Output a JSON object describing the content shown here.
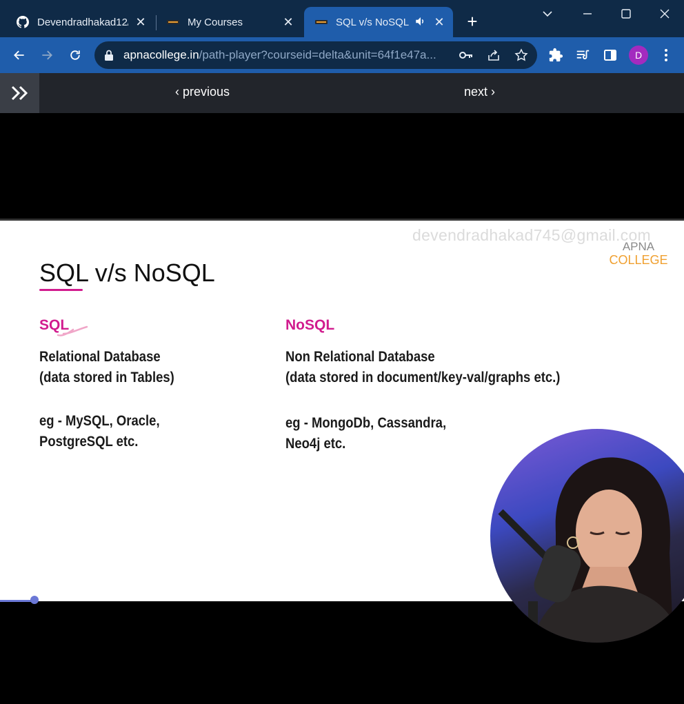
{
  "browser": {
    "tabs": [
      {
        "title": "Devendradhakad12/",
        "favicon": "github-icon"
      },
      {
        "title": "My Courses",
        "favicon": "apna-college-icon"
      },
      {
        "title": "SQL v/s NoSQL",
        "favicon": "apna-college-icon",
        "active": true,
        "audio": true
      }
    ],
    "new_tab_label": "+",
    "url": {
      "host": "apnacollege.in",
      "path": "/path-player?courseid=delta&unit=64f1e47a..."
    },
    "profile_initial": "D",
    "colors": {
      "tabstrip": "#0f2a47",
      "toolbar": "#1f5dab",
      "avatar": "#a32bbf"
    }
  },
  "page_nav": {
    "previous_label": "previous",
    "next_label": "next"
  },
  "slide": {
    "watermark": "devendradhakad745@gmail.com",
    "logo_top": "APNA",
    "logo_bottom": "COLLEGE",
    "title": "SQL v/s NoSQL",
    "left": {
      "heading": "SQL",
      "line1": "Relational Database",
      "line2": "(data stored in Tables)",
      "eg1": "eg - MySQL, Oracle,",
      "eg2": "PostgreSQL etc."
    },
    "right": {
      "heading": "NoSQL",
      "line1": "Non Relational Database",
      "line2": "(data stored in document/key-val/graphs etc.)",
      "eg1": "eg - MongoDb, Cassandra,",
      "eg2": "Neo4j etc."
    },
    "accent_color": "#d11b8e"
  },
  "video": {
    "progress": 0.05
  }
}
